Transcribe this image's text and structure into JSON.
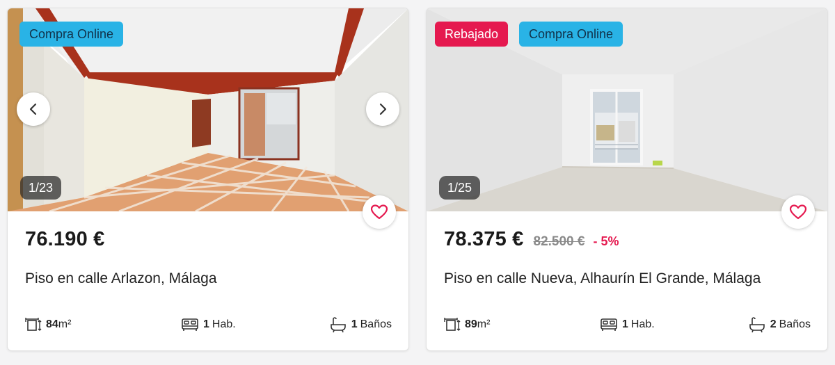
{
  "colors": {
    "online_badge": "#29b3e6",
    "sale_badge": "#e5194f",
    "heart": "#e5194f",
    "discount": "#e5194f"
  },
  "listings": [
    {
      "badges": [
        "Compra Online"
      ],
      "photo_counter": "1/23",
      "price": "76.190 €",
      "old_price": "",
      "discount": "",
      "title": "Piso en calle Arlazon, Málaga",
      "size_value": "84",
      "size_unit": "m²",
      "rooms_value": "1",
      "rooms_unit": "Hab.",
      "baths_value": "1",
      "baths_unit": "Baños",
      "icons": [
        "chevron-left-icon",
        "chevron-right-icon",
        "heart-icon",
        "area-icon",
        "bed-icon",
        "bath-icon"
      ]
    },
    {
      "badges": [
        "Rebajado",
        "Compra Online"
      ],
      "photo_counter": "1/25",
      "price": "78.375 €",
      "old_price": "82.500 €",
      "discount": "- 5%",
      "title": "Piso en calle Nueva, Alhaurín El Grande, Málaga",
      "size_value": "89",
      "size_unit": "m²",
      "rooms_value": "1",
      "rooms_unit": "Hab.",
      "baths_value": "2",
      "baths_unit": "Baños",
      "icons": [
        "heart-icon",
        "area-icon",
        "bed-icon",
        "bath-icon"
      ]
    }
  ]
}
